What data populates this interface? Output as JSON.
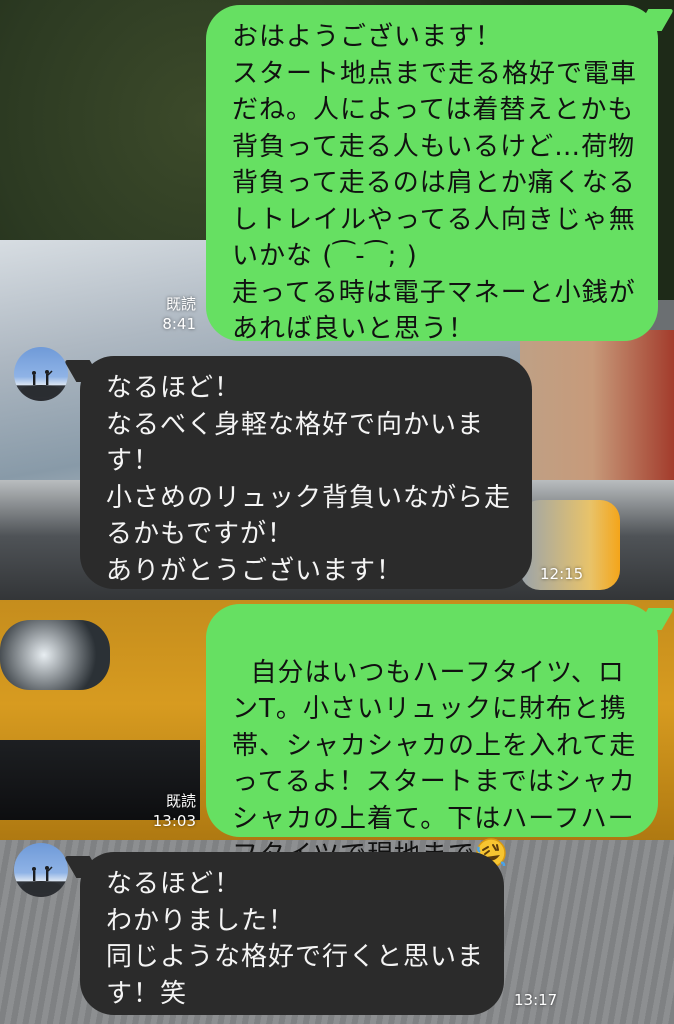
{
  "messages": [
    {
      "from": "me",
      "text": "おはようございます！\nスタート地点まで走る格好で電車だね。人によっては着替えとかも背負って走る人もいるけど…荷物背負って走るのは肩とか痛くなるしトレイルやってる人向きじゃ無いかな (⁀-⁀; )\n走ってる時は電子マネーと小銭があれば良いと思う！",
      "read": "既読",
      "time": "8:41"
    },
    {
      "from": "them",
      "text": "なるほど！\nなるべく身軽な格好で向かいます！\n小さめのリュック背負いながら走るかもですが！\nありがとうございます！",
      "time": "12:15"
    },
    {
      "from": "me",
      "text": "自分はいつもハーフタイツ、ロンT。小さいリュックに財布と携帯、シャカシャカの上を入れて走ってるよ！スタートまではシャカシャカの上着て。下はハーフハーフタイツで現地まで",
      "emoji": "rolling-on-floor-laughing-emoji",
      "read": "既読",
      "time": "13:03"
    },
    {
      "from": "them",
      "text": "なるほど！\nわかりました！\n同じような格好で行くと思います！笑",
      "time": "13:17"
    }
  ],
  "colors": {
    "mine_bubble": "#66e062",
    "their_bubble": "#2b2b2b",
    "their_text": "#f4f4f4"
  },
  "icons": {
    "avatar": "avatar-silhouettes-icon",
    "emoji": "rolling-on-floor-laughing-emoji"
  }
}
